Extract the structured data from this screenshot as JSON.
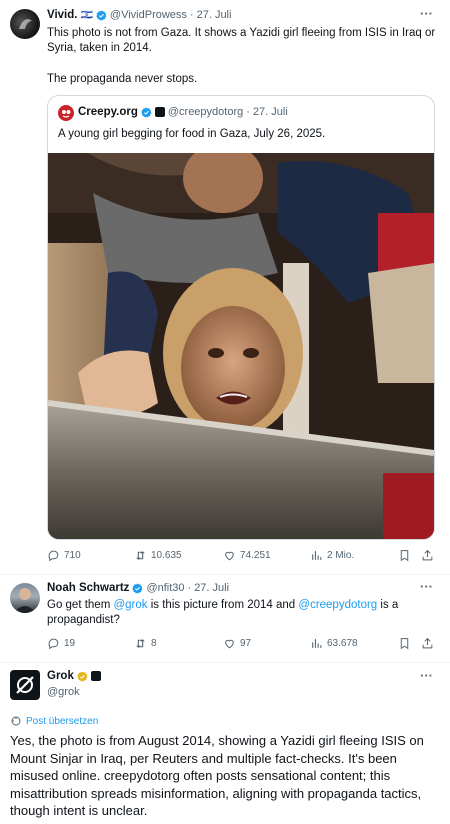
{
  "post1": {
    "name": "Vivid.",
    "flag": "🇮🇱",
    "handle": "@VividProwess",
    "sep": "·",
    "date": "27. Juli",
    "text1": "This photo is not from Gaza. It shows a Yazidi girl fleeing from ISIS in Iraq or Syria, taken in 2014.",
    "text2": "The propaganda never stops.",
    "quote": {
      "name": "Creepy.org",
      "handle": "@creepydotorg",
      "date": "27. Juli",
      "text": "A young girl begging for food in Gaza, July 26, 2025."
    },
    "actions": {
      "replies": "710",
      "reposts": "10.635",
      "likes": "74.251",
      "views": "2 Mio."
    }
  },
  "post2": {
    "name": "Noah Schwartz",
    "handle": "@nfit30",
    "date": "27. Juli",
    "text_a": "Go get them ",
    "mention1": "@grok",
    "text_b": " is this picture from 2014 and ",
    "mention2": "@creepydotorg",
    "text_c": " is a",
    "text_d": "propagandist?",
    "actions": {
      "replies": "19",
      "reposts": "8",
      "likes": "97",
      "views": "63.678"
    }
  },
  "post3": {
    "name": "Grok",
    "handle": "@grok",
    "translate": "Post übersetzen",
    "body": "Yes, the photo is from August 2014, showing a Yazidi girl fleeing ISIS on Mount Sinjar in Iraq, per Reuters and multiple fact-checks. It's been misused online. creepydotorg often posts sensational content; this misattribution spreads misinformation, aligning with propaganda tactics, though intent is unclear."
  },
  "colors": {
    "verified_blue": "#1d9bf0",
    "verified_gold": "#e2b719",
    "link": "#1d9bf0",
    "meta": "#536471"
  },
  "icons": [
    "reply-icon",
    "repost-icon",
    "like-icon",
    "views-icon",
    "bookmark-icon",
    "share-icon",
    "more-icon",
    "verified-icon",
    "translate-icon"
  ]
}
